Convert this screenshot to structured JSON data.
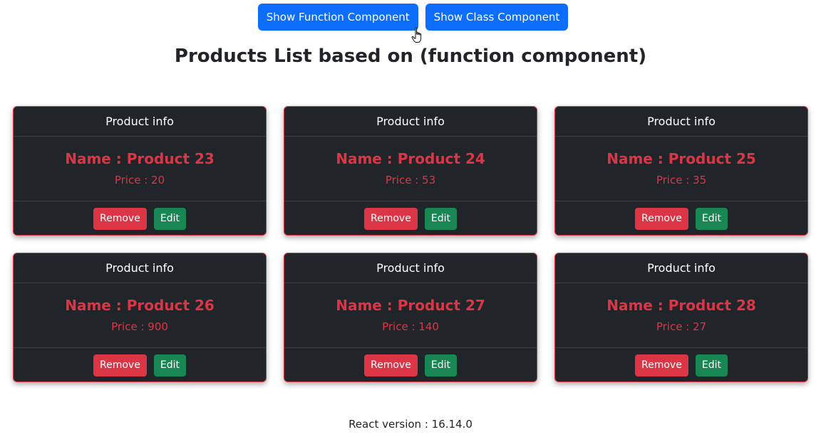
{
  "toolbar": {
    "show_function_label": "Show Function Component",
    "show_class_label": "Show Class Component"
  },
  "page": {
    "title": "Products List based on (function component)"
  },
  "products": [
    {
      "header": "Product info",
      "name": "Name : Product 23",
      "price": "Price : 20",
      "remove_label": "Remove",
      "edit_label": "Edit"
    },
    {
      "header": "Product info",
      "name": "Name : Product 24",
      "price": "Price : 53",
      "remove_label": "Remove",
      "edit_label": "Edit"
    },
    {
      "header": "Product info",
      "name": "Name : Product 25",
      "price": "Price : 35",
      "remove_label": "Remove",
      "edit_label": "Edit"
    },
    {
      "header": "Product info",
      "name": "Name : Product 26",
      "price": "Price : 900",
      "remove_label": "Remove",
      "edit_label": "Edit"
    },
    {
      "header": "Product info",
      "name": "Name : Product 27",
      "price": "Price : 140",
      "remove_label": "Remove",
      "edit_label": "Edit"
    },
    {
      "header": "Product info",
      "name": "Name : Product 28",
      "price": "Price : 27",
      "remove_label": "Remove",
      "edit_label": "Edit"
    }
  ],
  "footer": {
    "react_version": "React version : 16.14.0"
  },
  "colors": {
    "primary": "#0d6efd",
    "danger": "#dc3545",
    "success": "#198754",
    "card_bg": "#212529"
  },
  "cursor_icon": "hand-pointer-icon"
}
